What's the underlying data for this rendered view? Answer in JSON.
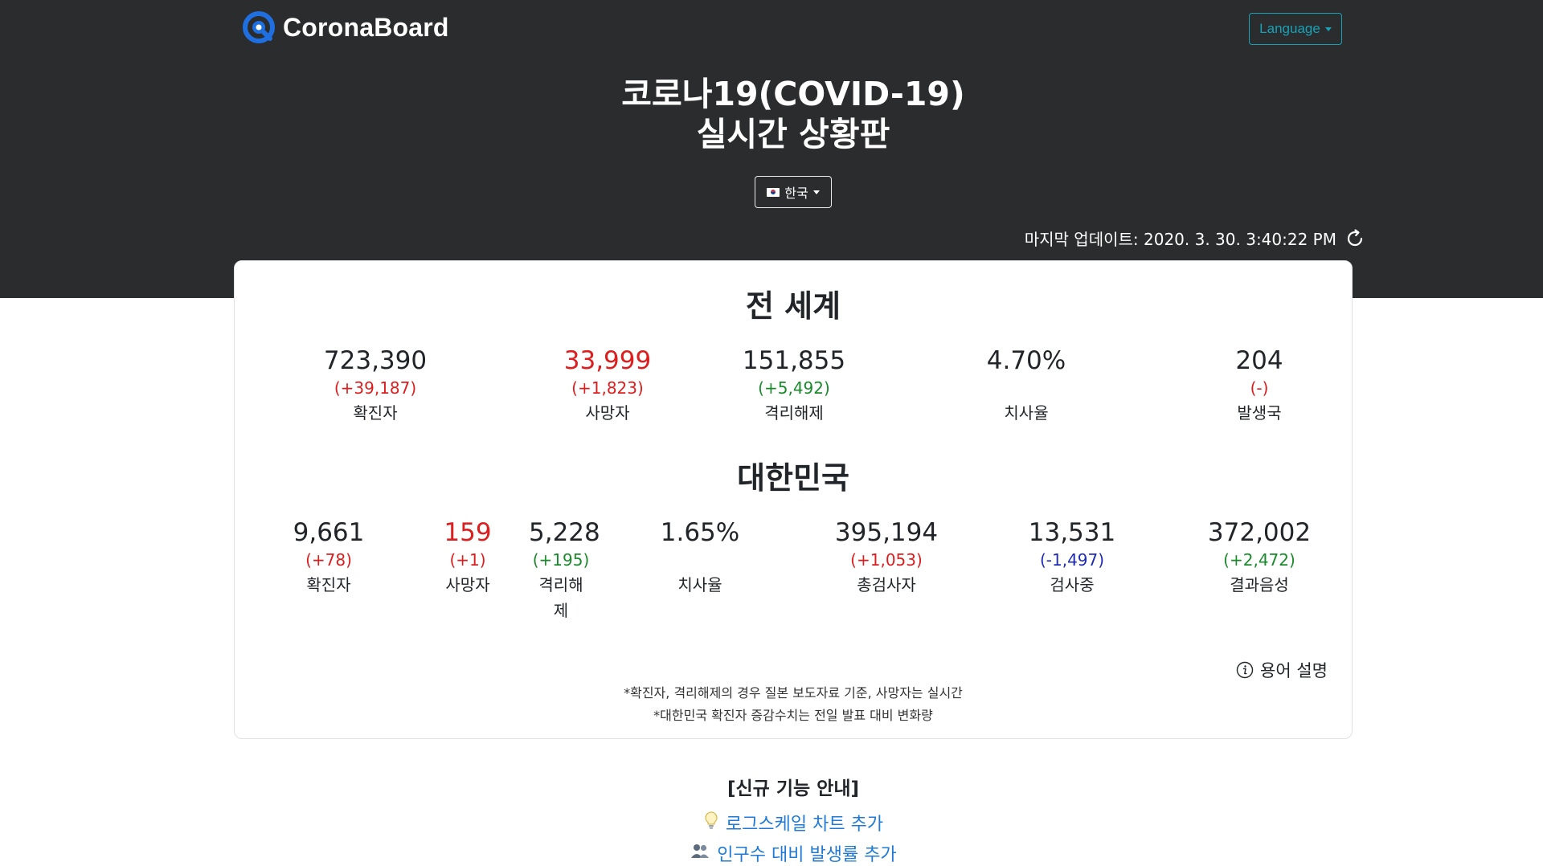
{
  "header": {
    "logo_text": "CoronaBoard",
    "language_button": "Language",
    "title_line1": "코로나19(COVID-19)",
    "title_line2": "실시간 상황판",
    "country_selector": "한국",
    "last_update": "마지막 업데이트: 2020. 3. 30. 3:40:22 PM"
  },
  "world": {
    "title": "전 세계",
    "stats": [
      {
        "value": "723,390",
        "delta": "(+39,187)",
        "label": "확진자",
        "value_color": "default",
        "delta_color": "red"
      },
      {
        "value": "33,999",
        "delta": "(+1,823)",
        "label": "사망자",
        "value_color": "red",
        "delta_color": "red"
      },
      {
        "value": "151,855",
        "delta": "(+5,492)",
        "label": "격리해제",
        "value_color": "default",
        "delta_color": "green"
      },
      {
        "value": "4.70%",
        "delta": "",
        "label": "치사율",
        "value_color": "default",
        "delta_color": "none"
      },
      {
        "value": "204",
        "delta": "(-)",
        "label": "발생국",
        "value_color": "default",
        "delta_color": "red"
      }
    ]
  },
  "korea": {
    "title": "대한민국",
    "stats": [
      {
        "value": "9,661",
        "delta": "(+78)",
        "label": "확진자",
        "value_color": "default",
        "delta_color": "red"
      },
      {
        "value": "159",
        "delta": "(+1)",
        "label": "사망자",
        "value_color": "red",
        "delta_color": "red"
      },
      {
        "value": "5,228",
        "delta": "(+195)",
        "label": "격리해제",
        "value_color": "default",
        "delta_color": "green"
      },
      {
        "value": "1.65%",
        "delta": "",
        "label": "치사율",
        "value_color": "default",
        "delta_color": "none"
      },
      {
        "value": "395,194",
        "delta": "(+1,053)",
        "label": "총검사자",
        "value_color": "default",
        "delta_color": "red"
      },
      {
        "value": "13,531",
        "delta": "(-1,497)",
        "label": "검사중",
        "value_color": "default",
        "delta_color": "blue"
      },
      {
        "value": "372,002",
        "delta": "(+2,472)",
        "label": "결과음성",
        "value_color": "default",
        "delta_color": "green"
      }
    ]
  },
  "glossary_link": "용어 설명",
  "notes": [
    "*확진자, 격리해제의 경우 질본 보도자료 기준, 사망자는 실시간",
    "*대한민국 확진자 증감수치는 전일 발표 대비 변화량"
  ],
  "news": {
    "title": "[신규 기능 안내]",
    "links": [
      {
        "icon": "lightbulb-icon",
        "label": "로그스케일 차트 추가"
      },
      {
        "icon": "people-icon",
        "label": "인구수 대비 발생률 추가"
      }
    ]
  },
  "colors": {
    "header_bg": "#2b2c2d",
    "accent_teal": "#17a2b8",
    "red": "#dc1e1e",
    "green": "#1a8a2a",
    "blue": "#1f2cb5",
    "link": "#1f7ad6"
  }
}
